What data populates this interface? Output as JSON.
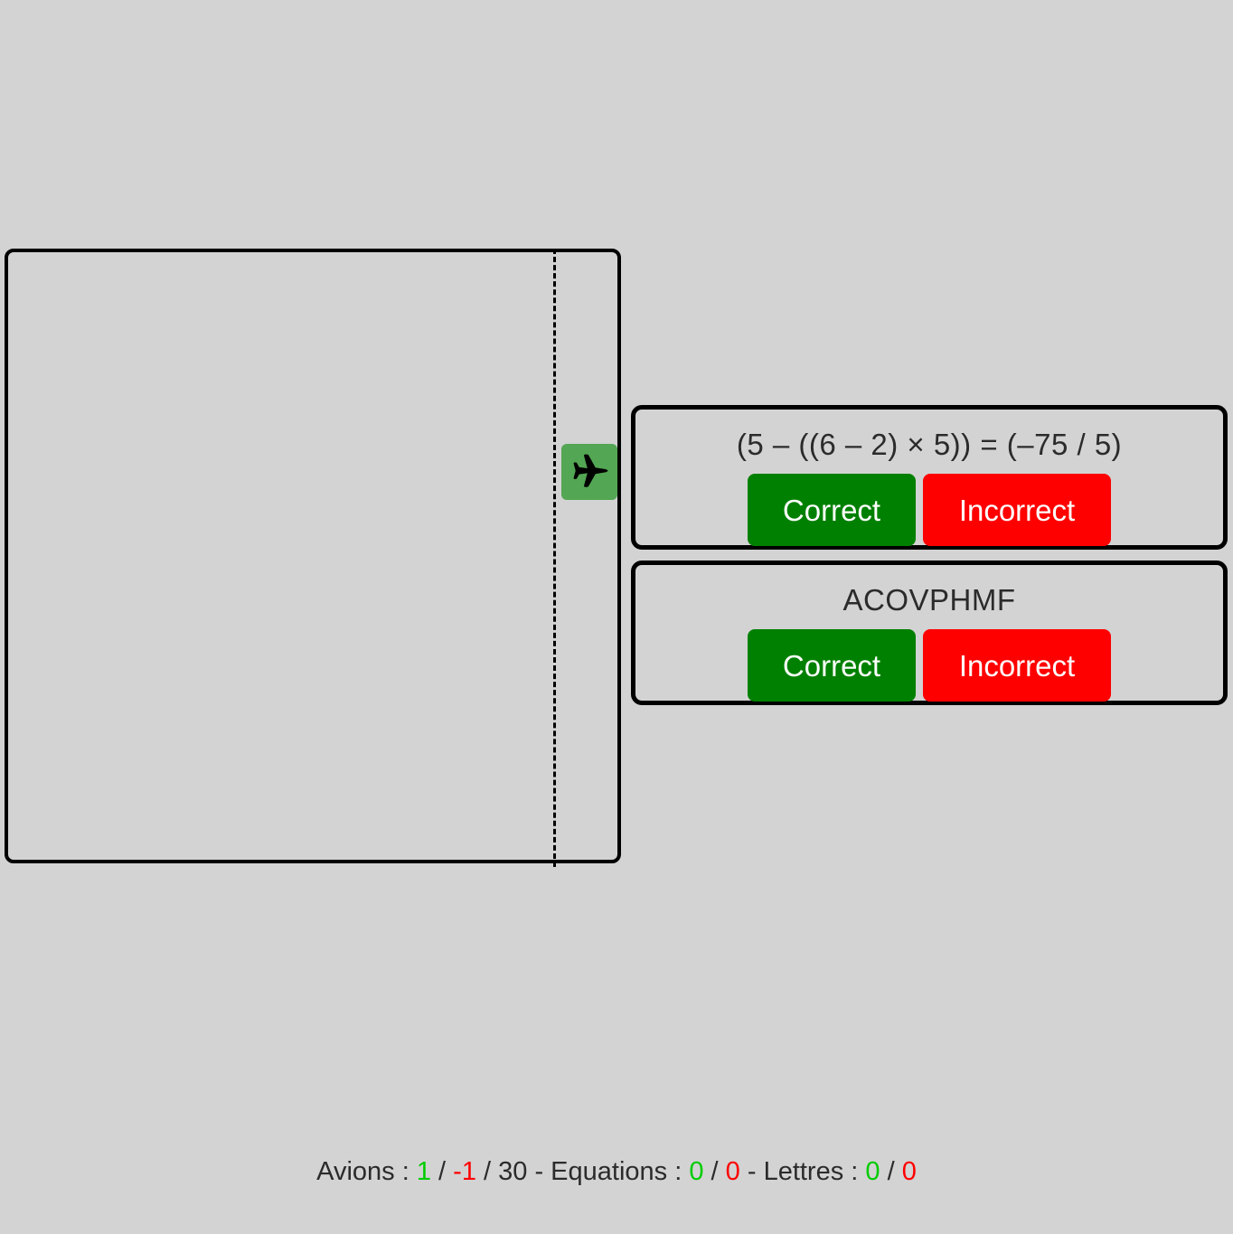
{
  "game": {
    "plane_icon": "airplane-icon",
    "plane_color": "#53a653",
    "runway_line_style": "dashed"
  },
  "equation_task": {
    "prompt": "(5 – ((6 – 2) × 5)) = (–75 / 5)",
    "correct_label": "Correct",
    "incorrect_label": "Incorrect"
  },
  "letters_task": {
    "prompt": "ACOVPHMF",
    "correct_label": "Correct",
    "incorrect_label": "Incorrect"
  },
  "status": {
    "planes_label": "Avions : ",
    "planes_hits": "1",
    "sep1": " / ",
    "planes_misses": "-1",
    "sep2": " / ",
    "planes_total": "30",
    "sep3": " - ",
    "equations_label": "Equations : ",
    "equations_correct": "0",
    "sep4": " / ",
    "equations_wrong": "0",
    "sep5": " - ",
    "letters_label": "Lettres : ",
    "letters_correct": "0",
    "sep6": " / ",
    "letters_wrong": "0",
    "colors": {
      "positive": "#00cc00",
      "negative": "#ff0000",
      "neutral": "#2b2b2b"
    }
  }
}
